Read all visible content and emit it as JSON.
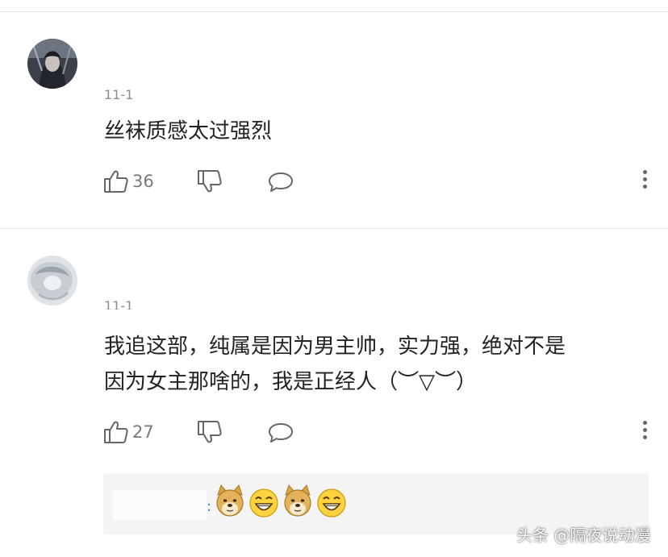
{
  "comments": [
    {
      "date": "11-1",
      "text": "丝袜质感太过强烈",
      "likes": "36",
      "avatar_icon": "dark-character-avatar"
    },
    {
      "date": "11-1",
      "text": "我追这部，纯属是因为男主帅，实力强，绝对不是\n因为女主那啥的，我是正经人（︶▽︶）",
      "likes": "27",
      "avatar_icon": "light-character-avatar",
      "reply": {
        "colon": ":",
        "emojis": [
          "doge-emoji",
          "grin-emoji",
          "doge-emoji",
          "grin-emoji"
        ]
      }
    }
  ],
  "watermark": "头条 @隔夜说动漫",
  "colors": {
    "text": "#222222",
    "meta": "#8c8c8c",
    "reply_bg": "#f4f4f4",
    "link": "#4a7bd0"
  }
}
